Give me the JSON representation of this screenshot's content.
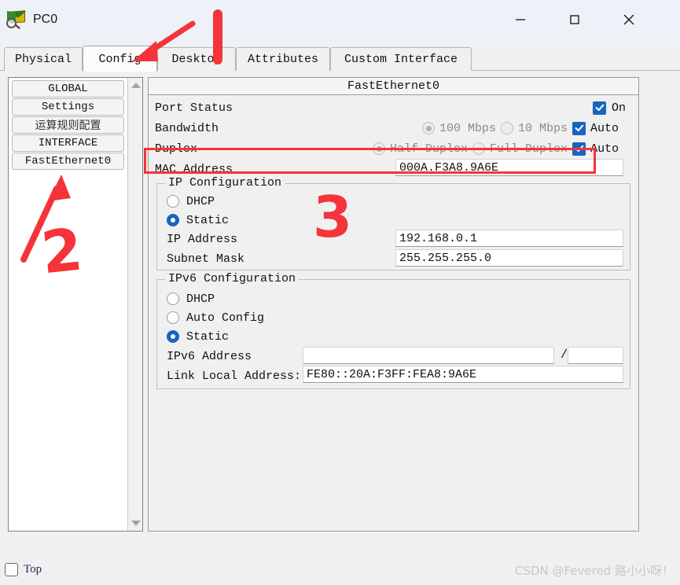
{
  "window": {
    "title": "PC0",
    "icon": "packet-tracer-device-icon",
    "controls": {
      "minimize": "–",
      "maximize": "□",
      "close": "✕"
    }
  },
  "tabs": [
    {
      "label": "Physical",
      "active": false
    },
    {
      "label": "Config",
      "active": true
    },
    {
      "label": "Desktop",
      "active": false
    },
    {
      "label": "Attributes",
      "active": false
    },
    {
      "label": "Custom Interface",
      "active": false
    }
  ],
  "sidebar": {
    "items": [
      {
        "label": "GLOBAL",
        "kind": "header"
      },
      {
        "label": "Settings",
        "kind": "item"
      },
      {
        "label": "运算规则配置",
        "kind": "item"
      },
      {
        "label": "INTERFACE",
        "kind": "header"
      },
      {
        "label": "FastEthernet0",
        "kind": "item"
      }
    ]
  },
  "panel": {
    "title": "FastEthernet0",
    "port_status": {
      "label": "Port Status",
      "on_label": "On",
      "on_checked": true
    },
    "bandwidth": {
      "label": "Bandwidth",
      "options": [
        {
          "label": "100 Mbps",
          "selected": true,
          "disabled": true
        },
        {
          "label": "10 Mbps",
          "selected": false,
          "disabled": true
        }
      ],
      "auto_label": "Auto",
      "auto_checked": true
    },
    "duplex": {
      "label": "Duplex",
      "options": [
        {
          "label": "Half Duplex",
          "selected": true,
          "disabled": true
        },
        {
          "label": "Full Duplex",
          "selected": false,
          "disabled": true
        }
      ],
      "auto_label": "Auto",
      "auto_checked": true
    },
    "mac": {
      "label": "MAC Address",
      "value": "000A.F3A8.9A6E"
    },
    "ip_config": {
      "title": "IP Configuration",
      "dhcp_label": "DHCP",
      "static_label": "Static",
      "mode": "Static",
      "ip_address_label": "IP Address",
      "ip_address_value": "192.168.0.1",
      "subnet_mask_label": "Subnet Mask",
      "subnet_mask_value": "255.255.255.0"
    },
    "ipv6_config": {
      "title": "IPv6 Configuration",
      "dhcp_label": "DHCP",
      "auto_config_label": "Auto Config",
      "static_label": "Static",
      "mode": "Static",
      "address_label": "IPv6 Address",
      "address_value": "",
      "prefix_separator": "/",
      "prefix_value": "",
      "link_local_label": "Link Local Address:",
      "link_local_value": "FE80::20A:F3FF:FEA8:9A6E"
    }
  },
  "footer": {
    "top_label": "Top",
    "top_checked": false,
    "watermark": "CSDN @Fevered 路小小呀！"
  },
  "annotations": {
    "color": "#f5333a",
    "marks": [
      {
        "id": "1",
        "text": "1",
        "kind": "number-with-arrow",
        "target": "tab-config"
      },
      {
        "id": "2",
        "text": "2",
        "kind": "number-with-arrow",
        "target": "sidebar-item-fastethernet0"
      },
      {
        "id": "3",
        "text": "3",
        "kind": "number",
        "target": "ip-configuration-group"
      },
      {
        "id": "box",
        "text": "",
        "kind": "rectangle",
        "target": "mac-address-row"
      }
    ]
  }
}
